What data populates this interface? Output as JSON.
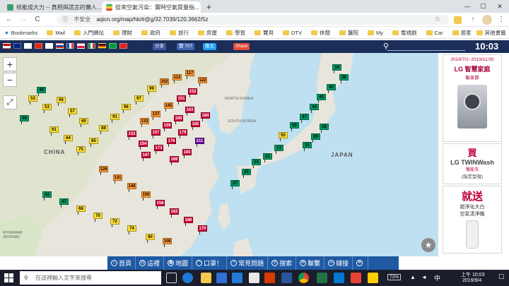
{
  "tabs": [
    {
      "title": "核能成大力 -- 真相與謊言的懶人...",
      "active": false
    },
    {
      "title": "從來空氣污染：實時空氣質量指...",
      "active": true
    }
  ],
  "new_tab_label": "+",
  "window_controls": {
    "minimize": "—",
    "maximize": "☐",
    "close": "✕"
  },
  "toolbar": {
    "back": "←",
    "forward": "→",
    "reload": "C",
    "security_label": "不安全",
    "url": "aqicn.org/map/hk/#@g/32.7039/120.3662/5z"
  },
  "bookmarks": {
    "apps_label": "Bookmarks",
    "items": [
      "Mail",
      "入門網站",
      "理財",
      "政府",
      "旅行",
      "房屋",
      "學習",
      "寶貝",
      "DTV",
      "休閒",
      "醫院",
      "My",
      "電視劇",
      "Car",
      "居家"
    ],
    "other_label": "其他書籤"
  },
  "site": {
    "share_buttons": [
      "分享",
      "贊 707",
      "推文",
      "Share"
    ],
    "clock": "10:03"
  },
  "map": {
    "zoom_in": "+",
    "zoom_out": "−",
    "fullscreen": "⤢",
    "labels": [
      "CHINA",
      "NORTH KOREA",
      "SOUTH KOREA",
      "JAPAN",
      "MYANMAR (BURMA)"
    ],
    "aqi_colors": {
      "good": "#009966",
      "moderate": "#ffde33",
      "sensitive": "#ff9933",
      "unhealthy": "#cc0033",
      "very_unhealthy": "#660099"
    },
    "markers": [
      {
        "v": "46"
      },
      {
        "v": "49"
      },
      {
        "v": "53"
      },
      {
        "v": "53"
      },
      {
        "v": "56"
      },
      {
        "v": "57"
      },
      {
        "v": "60"
      },
      {
        "v": "61"
      },
      {
        "v": "64"
      },
      {
        "v": "75"
      },
      {
        "v": "85"
      },
      {
        "v": "89"
      },
      {
        "v": "91"
      },
      {
        "v": "96"
      },
      {
        "v": "97"
      },
      {
        "v": "99"
      },
      {
        "v": "102"
      },
      {
        "v": "112"
      },
      {
        "v": "117"
      },
      {
        "v": "122"
      },
      {
        "v": "133"
      },
      {
        "v": "137"
      },
      {
        "v": "142"
      },
      {
        "v": "151"
      },
      {
        "v": "152"
      },
      {
        "v": "153"
      },
      {
        "v": "154"
      },
      {
        "v": "157"
      },
      {
        "v": "159"
      },
      {
        "v": "160"
      },
      {
        "v": "163"
      },
      {
        "v": "167"
      },
      {
        "v": "173"
      },
      {
        "v": "176"
      },
      {
        "v": "179"
      },
      {
        "v": "182"
      },
      {
        "v": "184"
      },
      {
        "v": "189"
      },
      {
        "v": "193"
      },
      {
        "v": "211"
      },
      {
        "v": "34"
      },
      {
        "v": "36"
      },
      {
        "v": "40"
      },
      {
        "v": "43"
      },
      {
        "v": "44"
      },
      {
        "v": "47"
      },
      {
        "v": "50"
      },
      {
        "v": "55"
      },
      {
        "v": "13"
      },
      {
        "v": "21"
      },
      {
        "v": "24"
      },
      {
        "v": "25"
      },
      {
        "v": "27"
      },
      {
        "v": "28"
      },
      {
        "v": "29"
      },
      {
        "v": "31"
      },
      {
        "v": "42"
      },
      {
        "v": "47"
      },
      {
        "v": "68"
      },
      {
        "v": "70"
      },
      {
        "v": "72"
      },
      {
        "v": "74"
      },
      {
        "v": "80"
      },
      {
        "v": "108"
      },
      {
        "v": "126"
      },
      {
        "v": "131"
      },
      {
        "v": "140"
      },
      {
        "v": "150"
      },
      {
        "v": "158"
      },
      {
        "v": "162"
      },
      {
        "v": "166"
      },
      {
        "v": "170"
      }
    ]
  },
  "ads": {
    "date_range": "2019/7/1~2019/11/30",
    "brand": "LG 智慧家庭",
    "brand_sub": "聯享節",
    "buy": "買",
    "product": "LG TWINWash",
    "product_tag": "雙能洗",
    "product_note": "(指定型號)",
    "gift": "就送",
    "gift_line1": "超淨化大白",
    "gift_line2": "空氣清淨機"
  },
  "bottom_nav": [
    {
      "icon": "home-icon",
      "label": "首頁"
    },
    {
      "icon": "globe-icon",
      "label": "這裡"
    },
    {
      "icon": "map-icon",
      "label": "地圖"
    },
    {
      "icon": "mask-icon",
      "label": "口罩！"
    },
    {
      "icon": "question-icon",
      "label": "常見問題"
    },
    {
      "icon": "search-icon",
      "label": "搜索"
    },
    {
      "icon": "mail-icon",
      "label": "聯繫"
    },
    {
      "icon": "link-icon",
      "label": "鏈接"
    },
    {
      "icon": "gear-icon",
      "label": ""
    }
  ],
  "taskbar": {
    "search_placeholder": "在這裡輸入文字來搜尋",
    "ime": "中",
    "battery": "72%",
    "time_line1": "上午 10:03",
    "time_line2": "2019/9/4"
  }
}
